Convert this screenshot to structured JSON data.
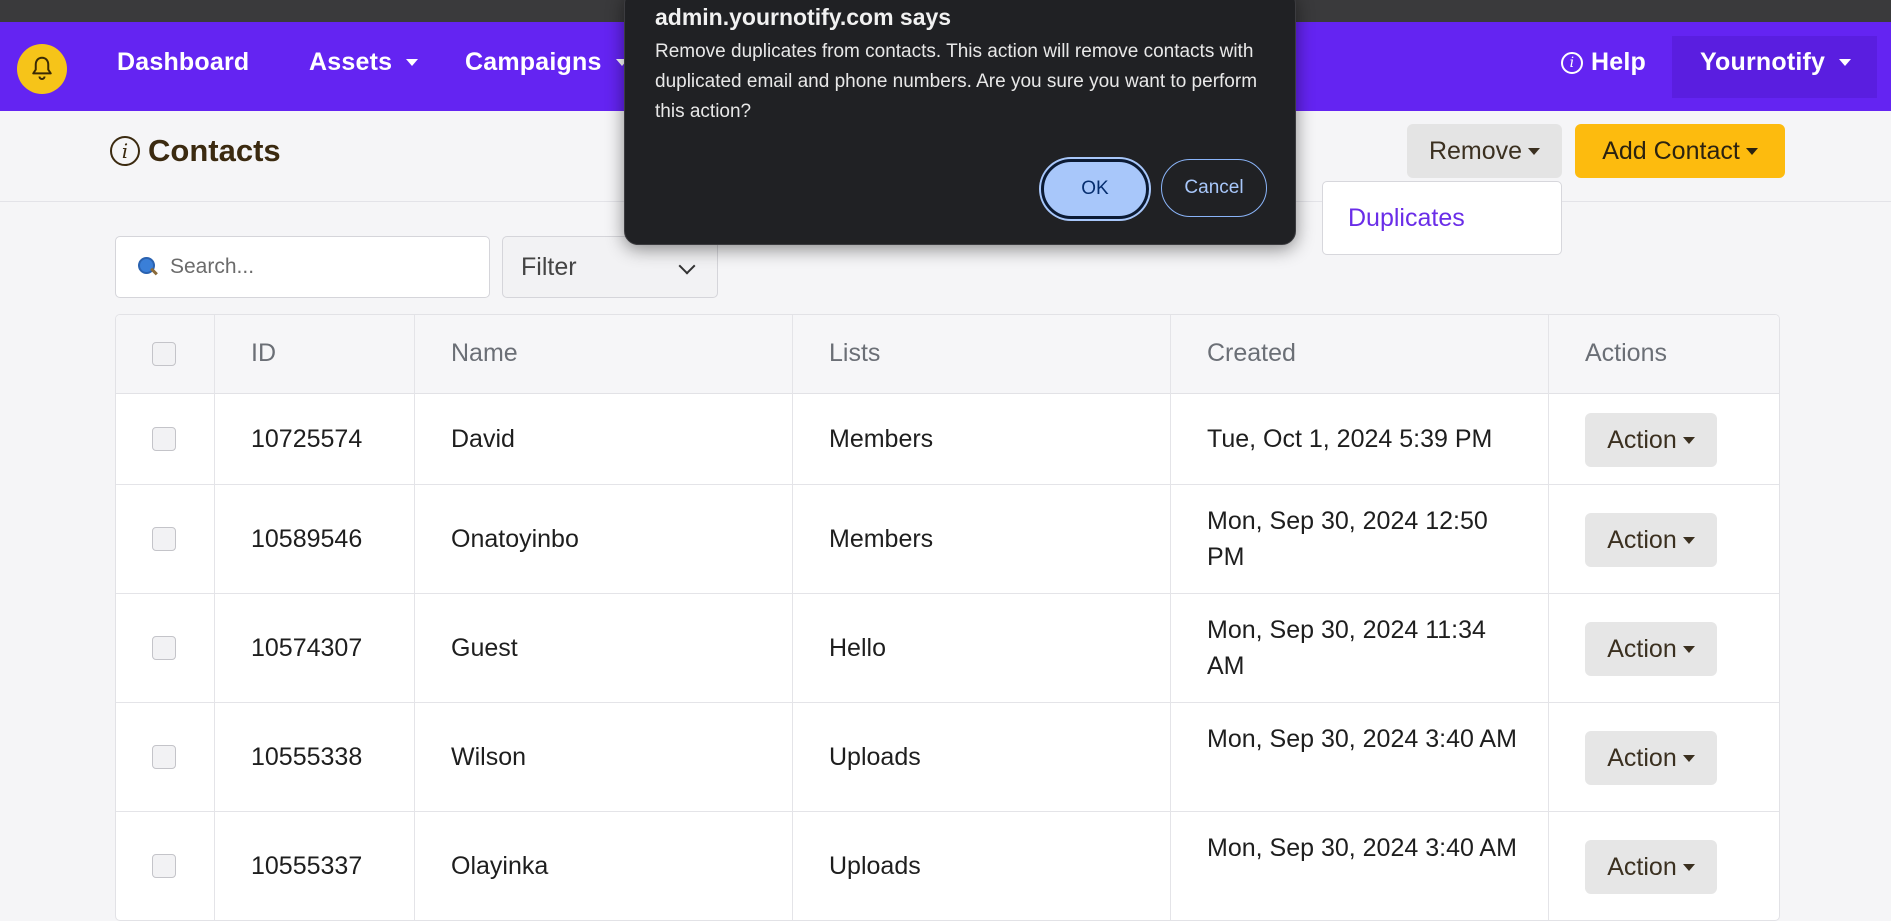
{
  "nav": {
    "items": [
      {
        "label": "Dashboard",
        "dropdown": false
      },
      {
        "label": "Assets",
        "dropdown": true
      },
      {
        "label": "Campaigns",
        "dropdown": true
      }
    ],
    "help_label": "Help",
    "user_label": "Yournotify"
  },
  "page": {
    "title": "Contacts",
    "remove_label": "Remove",
    "add_label": "Add Contact",
    "remove_menu": [
      "Duplicates"
    ]
  },
  "search": {
    "placeholder": "Search...",
    "value": ""
  },
  "filter": {
    "selected": "Filter"
  },
  "table": {
    "columns": [
      "ID",
      "Name",
      "Lists",
      "Created",
      "Actions"
    ],
    "action_label": "Action",
    "rows": [
      {
        "id": "10725574",
        "name": "David",
        "list": "Members",
        "created": "Tue, Oct 1, 2024 5:39 PM"
      },
      {
        "id": "10589546",
        "name": "Onatoyinbo",
        "list": "Members",
        "created": "Mon, Sep 30, 2024 12:50 PM"
      },
      {
        "id": "10574307",
        "name": "Guest",
        "list": "Hello",
        "created": "Mon, Sep 30, 2024 11:34 AM"
      },
      {
        "id": "10555338",
        "name": "Wilson",
        "list": "Uploads",
        "created": "Mon, Sep 30, 2024 3:40 AM"
      },
      {
        "id": "10555337",
        "name": "Olayinka",
        "list": "Uploads",
        "created": "Mon, Sep 30, 2024 3:40 AM"
      }
    ]
  },
  "dialog": {
    "title": "admin.yournotify.com says",
    "message": "Remove duplicates from contacts. This action will remove contacts with duplicated email and phone numbers. Are you sure you want to perform this action?",
    "ok_label": "OK",
    "cancel_label": "Cancel"
  },
  "colors": {
    "brand": "#6424f2",
    "accent": "#fdbb0e",
    "dialog_bg": "#202124"
  }
}
